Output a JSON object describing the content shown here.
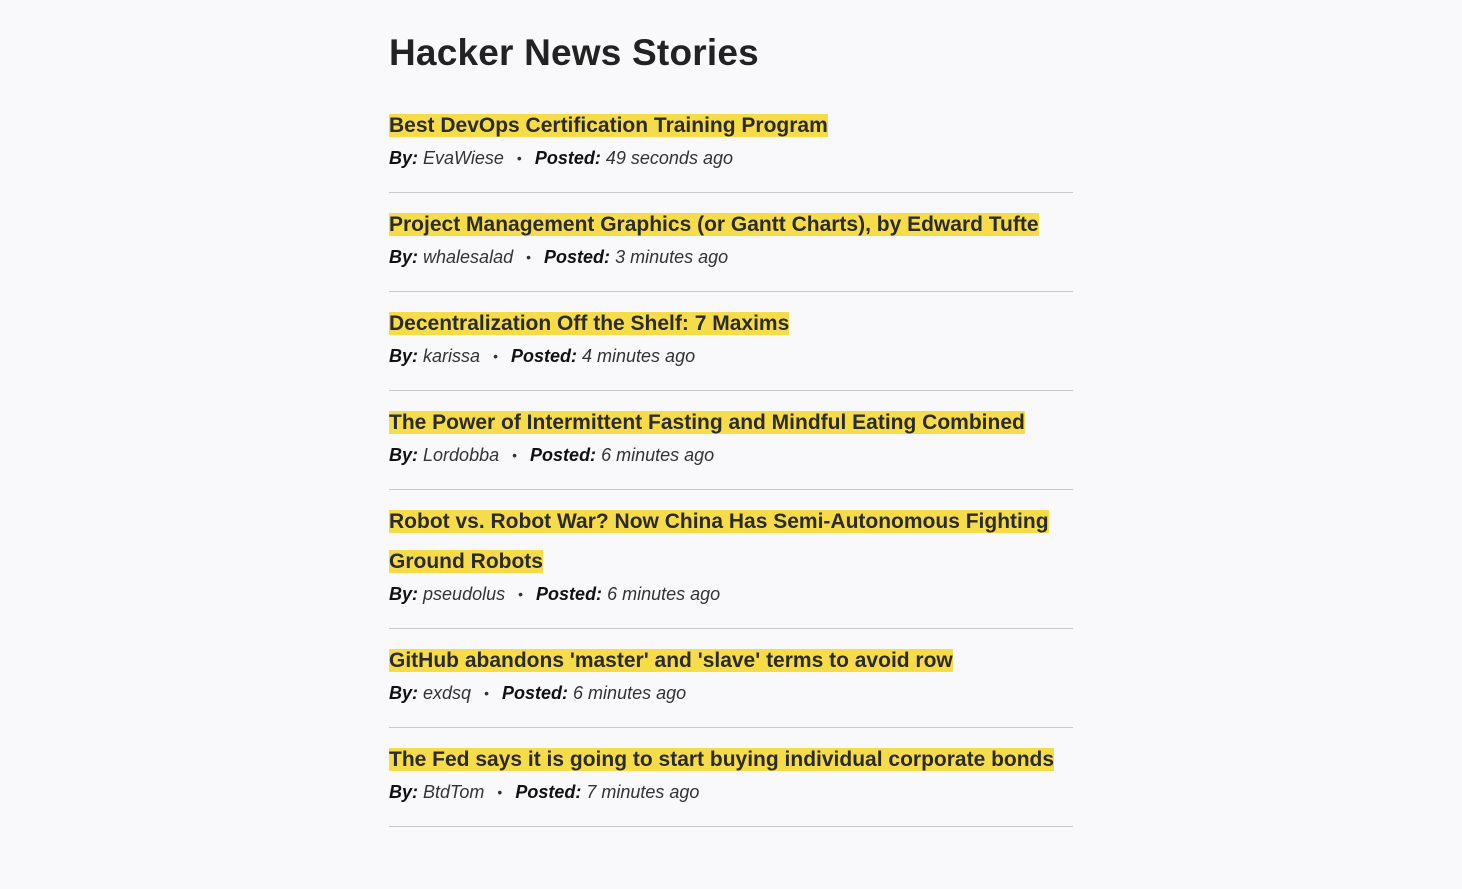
{
  "page": {
    "title": "Hacker News Stories",
    "by_label": "By:",
    "posted_label": "Posted:",
    "separator": "•"
  },
  "stories": [
    {
      "title": "Best DevOps Certification Training Program",
      "author": "EvaWiese",
      "posted": "49 seconds ago"
    },
    {
      "title": "Project Management Graphics (or Gantt Charts), by Edward Tufte",
      "author": "whalesalad",
      "posted": "3 minutes ago"
    },
    {
      "title": "Decentralization Off the Shelf: 7 Maxims",
      "author": "karissa",
      "posted": "4 minutes ago"
    },
    {
      "title": "The Power of Intermittent Fasting and Mindful Eating Combined",
      "author": "Lordobba",
      "posted": "6 minutes ago"
    },
    {
      "title": "Robot vs. Robot War? Now China Has Semi-Autonomous Fighting Ground Robots",
      "author": "pseudolus",
      "posted": "6 minutes ago"
    },
    {
      "title": "GitHub abandons 'master' and 'slave' terms to avoid row",
      "author": "exdsq",
      "posted": "6 minutes ago"
    },
    {
      "title": "The Fed says it is going to start buying individual corporate bonds",
      "author": "BtdTom",
      "posted": "7 minutes ago"
    }
  ],
  "colors": {
    "highlight": "#f7dc4a",
    "background": "#f9f9fc",
    "divider": "#c8c8c8"
  }
}
